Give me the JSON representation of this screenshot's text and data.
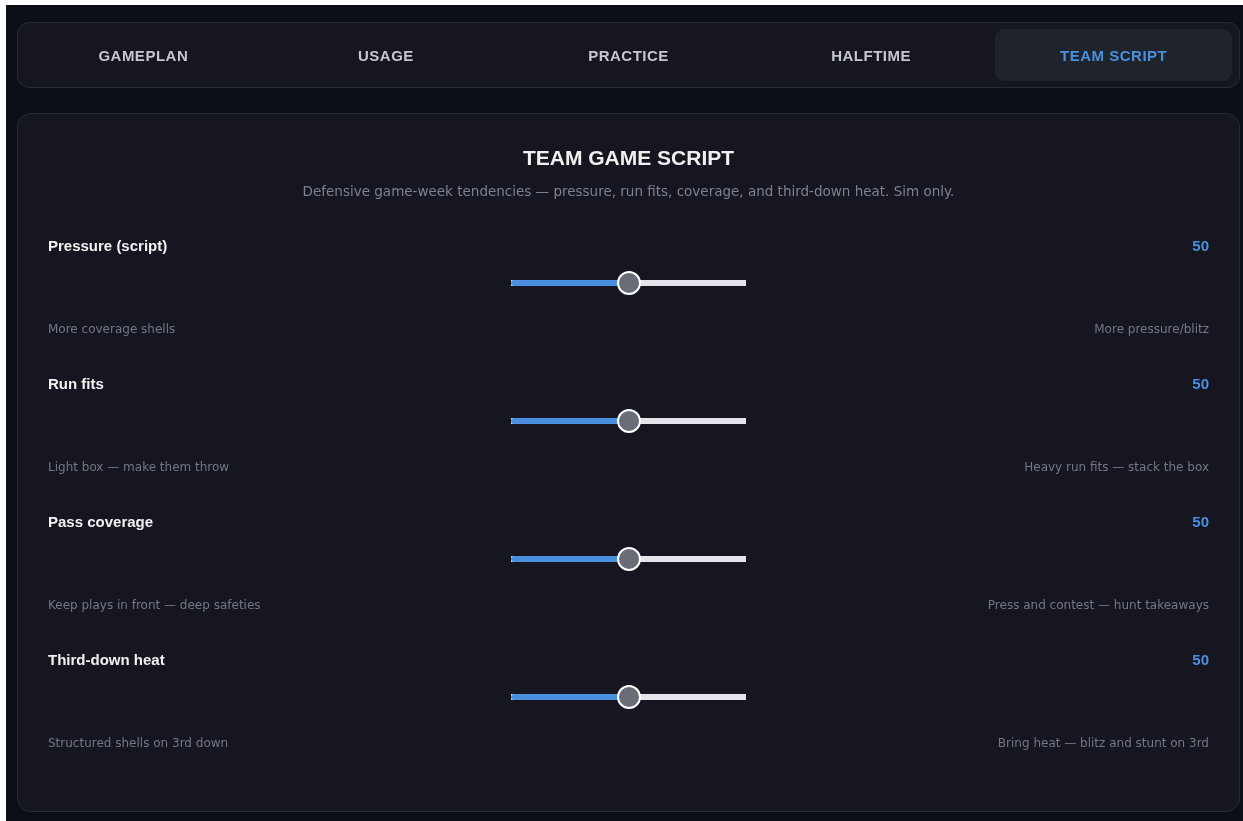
{
  "tabs": [
    {
      "label": "GAMEPLAN",
      "selected": false
    },
    {
      "label": "USAGE",
      "selected": false
    },
    {
      "label": "PRACTICE",
      "selected": false
    },
    {
      "label": "HALFTIME",
      "selected": false
    },
    {
      "label": "TEAM SCRIPT",
      "selected": true
    }
  ],
  "panel": {
    "title": "TEAM GAME SCRIPT",
    "subtitle": "Defensive game-week tendencies — pressure, run fits, coverage, and third-down heat. Sim only.",
    "sliders": [
      {
        "label": "Pressure (script)",
        "value": "50",
        "level": 0.5,
        "min_caption": "More coverage shells",
        "max_caption": "More pressure/blitz"
      },
      {
        "label": "Run fits",
        "value": "50",
        "level": 0.5,
        "min_caption": "Light box — make them throw",
        "max_caption": "Heavy run fits — stack the box"
      },
      {
        "label": "Pass coverage",
        "value": "50",
        "level": 0.5,
        "min_caption": "Keep plays in front — deep safeties",
        "max_caption": "Press and contest — hunt takeaways"
      },
      {
        "label": "Third-down heat",
        "value": "50",
        "level": 0.5,
        "min_caption": "Structured shells on 3rd down",
        "max_caption": "Bring heat — blitz and stunt on 3rd"
      }
    ]
  }
}
